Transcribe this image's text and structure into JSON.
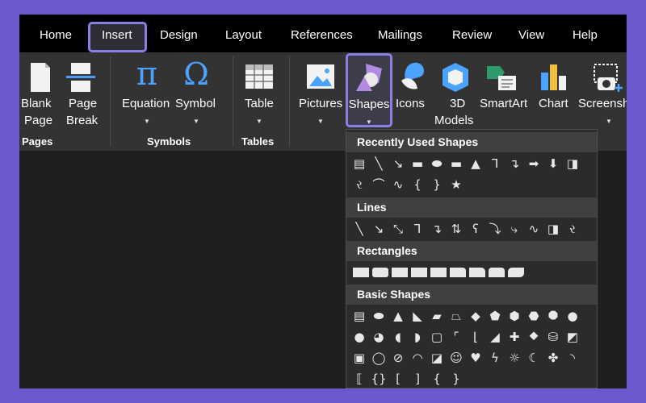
{
  "tabs": [
    "Home",
    "Insert",
    "Design",
    "Layout",
    "References",
    "Mailings",
    "Review",
    "View",
    "Help"
  ],
  "active_tab": "Insert",
  "accent_color": "#8a7fe6",
  "ribbon": {
    "blank_page": "Blank Page",
    "blank_page_l1": "Blank",
    "blank_page_l2": "Page",
    "page_break_l1": "Page",
    "page_break_l2": "Break",
    "equation": "Equation",
    "symbol": "Symbol",
    "table": "Table",
    "pictures": "Pictures",
    "shapes": "Shapes",
    "icons": "Icons",
    "models_l1": "3D",
    "models_l2": "Models",
    "smartart": "SmartArt",
    "chart": "Chart",
    "screenshot": "Screensh",
    "groups": {
      "pages": "Pages",
      "symbols": "Symbols",
      "tables": "Tables"
    }
  },
  "shapes_menu": {
    "sections": {
      "recent": "Recently Used Shapes",
      "lines": "Lines",
      "rectangles": "Rectangles",
      "basic": "Basic Shapes"
    },
    "recent_row1": [
      "text-box",
      "line",
      "arrow-line",
      "rectangle",
      "oval",
      "rounded-rectangle",
      "triangle",
      "elbow-connector",
      "elbow-arrow-connector",
      "right-arrow",
      "down-arrow",
      "snip-rectangle"
    ],
    "recent_row2": [
      "freeform-scribble",
      "curve",
      "arc-curve",
      "left-brace",
      "right-brace",
      "star"
    ],
    "lines_row": [
      "line",
      "arrow",
      "double-arrow",
      "elbow",
      "elbow-arrow",
      "elbow-double-arrow",
      "curve",
      "curved-arrow",
      "curved-double-arrow",
      "freeform-curve",
      "freeform-shape",
      "scribble"
    ],
    "rectangles_row": [
      "rectangle",
      "rounded-rectangle",
      "snip-single-corner",
      "snip-same-side",
      "snip-diagonal",
      "snip-round-single",
      "round-single-corner",
      "round-same-side",
      "round-diagonal"
    ],
    "basic_rows": [
      [
        "text-box",
        "oval",
        "triangle",
        "right-triangle",
        "parallelogram",
        "trapezoid",
        "diamond",
        "pentagon",
        "hexagon",
        "heptagon",
        "octagon",
        "decagon"
      ],
      [
        "dodecagon",
        "pie",
        "chord",
        "teardrop",
        "frame",
        "half-frame",
        "l-shape",
        "diagonal-stripe",
        "cross",
        "plaque",
        "can",
        "cube"
      ],
      [
        "bevel",
        "donut",
        "no-symbol",
        "block-arc",
        "folded-corner",
        "smiley-face",
        "heart",
        "lightning-bolt",
        "sun",
        "moon",
        "cloud",
        "arc"
      ],
      [
        "double-bracket",
        "double-brace",
        "left-bracket",
        "right-bracket",
        "left-brace",
        "right-brace"
      ]
    ]
  }
}
